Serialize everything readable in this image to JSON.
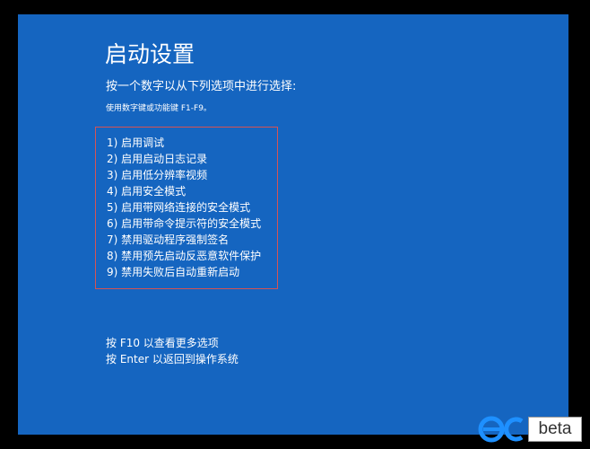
{
  "screen": {
    "title": "启动设置",
    "subtitle": "按一个数字以从下列选项中进行选择:",
    "hint": "使用数字键或功能键 F1-F9。",
    "background_color": "#1565c0",
    "highlight_border_color": "#d65353"
  },
  "options": [
    {
      "label": "1) 启用调试"
    },
    {
      "label": "2) 启用启动日志记录"
    },
    {
      "label": "3) 启用低分辨率视频"
    },
    {
      "label": "4) 启用安全模式"
    },
    {
      "label": "5) 启用带网络连接的安全模式"
    },
    {
      "label": "6) 启用带命令提示符的安全模式"
    },
    {
      "label": "7) 禁用驱动程序强制签名"
    },
    {
      "label": "8) 禁用预先启动反恶意软件保护"
    },
    {
      "label": "9) 禁用失败后自动重新启动"
    }
  ],
  "footer": {
    "more_options": "按 F10 以查看更多选项",
    "return_to_os": "按 Enter 以返回到操作系统"
  },
  "watermark": {
    "logo_icon": "pcbeta-logo-icon",
    "badge_text": "beta"
  }
}
